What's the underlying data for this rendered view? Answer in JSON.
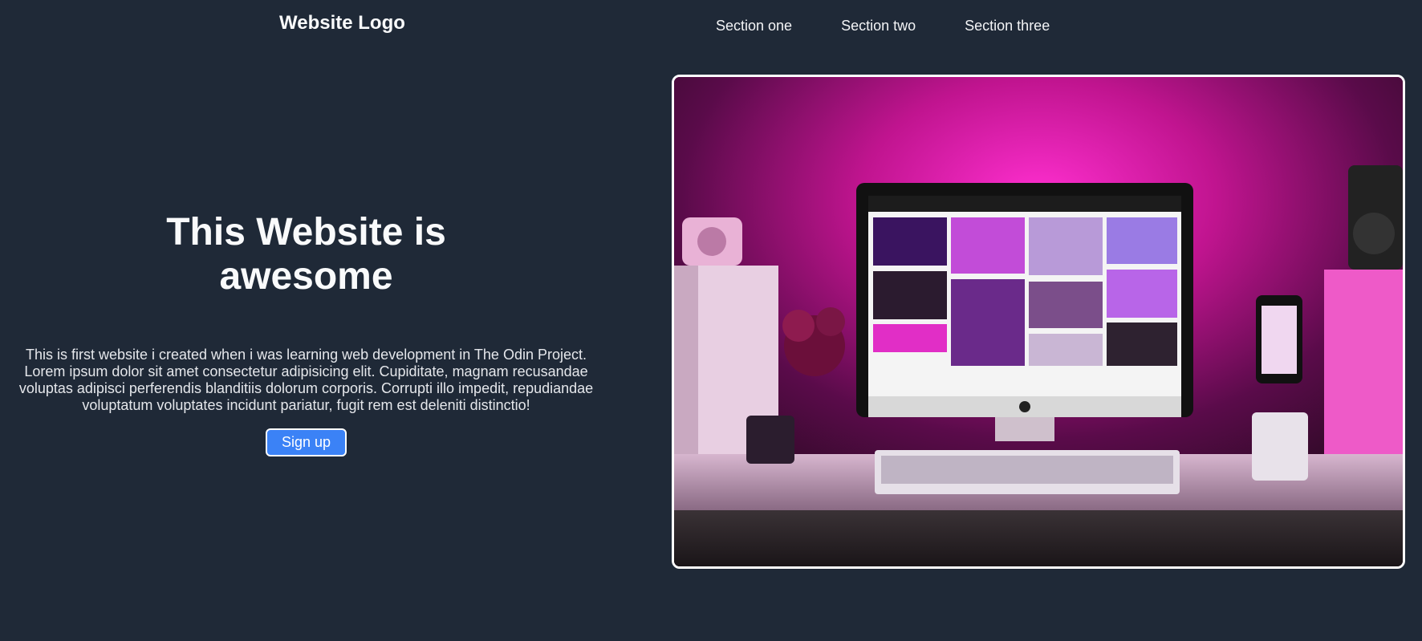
{
  "header": {
    "logo": "Website Logo",
    "nav": [
      "Section one",
      "Section two",
      "Section three"
    ]
  },
  "hero": {
    "title": "This Website is awesome",
    "text": "This is first website i created when i was learning web development in The Odin Project. Lorem ipsum dolor sit amet consectetur adipisicing elit. Cupiditate, magnam recusandae voluptas adipisci perferendis blanditiis dolorum corporis. Corrupti illo impedit, repudiandae voluptatum voluptates incidunt pariatur, fugit rem est deleniti distinctio!",
    "button": "Sign up"
  },
  "colors": {
    "background": "#1f2937",
    "button": "#3b82f6",
    "text": "#f9fafb"
  }
}
